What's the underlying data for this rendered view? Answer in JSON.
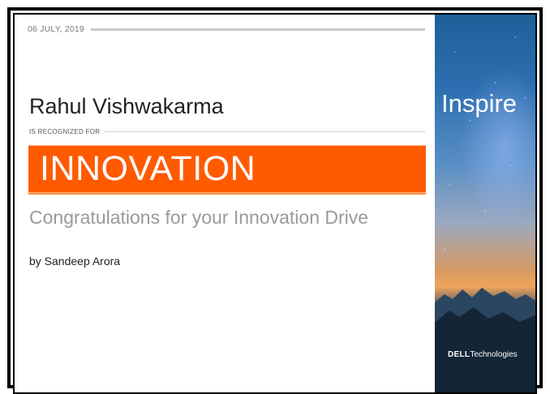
{
  "certificate": {
    "date": "06 JULY, 2019",
    "recipient": "Rahul Vishwakarma",
    "recognized_label": "IS RECOGNIZED FOR",
    "award": "INNOVATION",
    "message": "Congratulations for your Innovation Drive",
    "byline": "by Sandeep Arora"
  },
  "side_panel": {
    "tagline": "Inspire",
    "brand_dell": "DELL",
    "brand_technologies": "Technologies"
  },
  "colors": {
    "award_band": "#ff5a00",
    "frame": "#000000"
  }
}
